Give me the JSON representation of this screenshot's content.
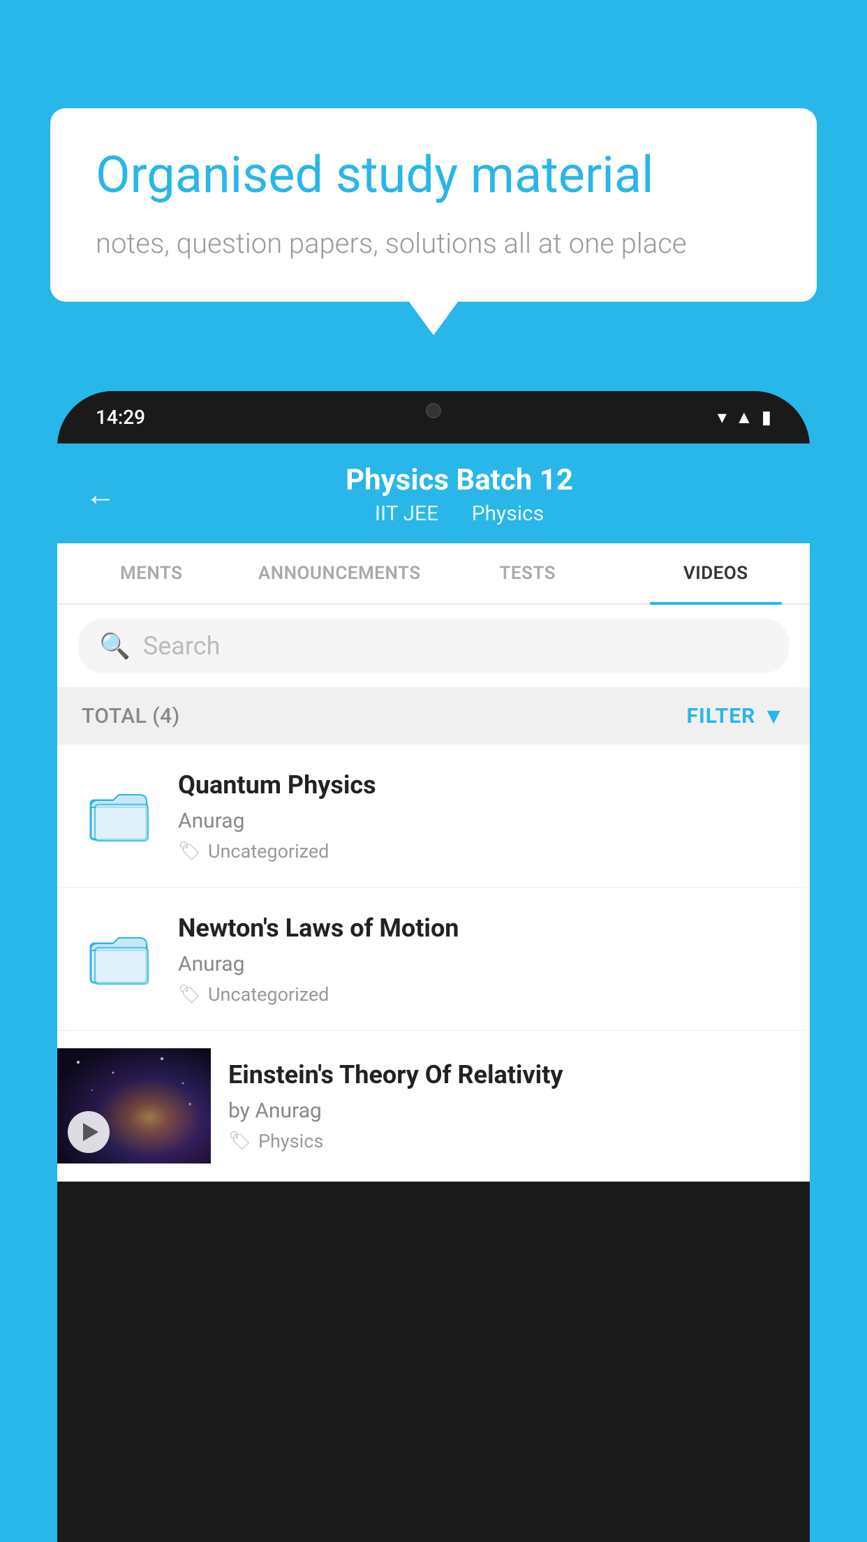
{
  "background_color": "#29b6e8",
  "bubble": {
    "title": "Organised study material",
    "subtitle": "notes, question papers, solutions all at one place"
  },
  "status_bar": {
    "time": "14:29",
    "icons": [
      "wifi",
      "signal",
      "battery"
    ]
  },
  "header": {
    "title": "Physics Batch 12",
    "tag1": "IIT JEE",
    "tag2": "Physics",
    "back_label": "←"
  },
  "tabs": [
    {
      "label": "MENTS",
      "active": false
    },
    {
      "label": "ANNOUNCEMENTS",
      "active": false
    },
    {
      "label": "TESTS",
      "active": false
    },
    {
      "label": "VIDEOS",
      "active": true
    }
  ],
  "search": {
    "placeholder": "Search"
  },
  "filter": {
    "total_label": "TOTAL (4)",
    "filter_label": "FILTER"
  },
  "videos": [
    {
      "title": "Quantum Physics",
      "author": "Anurag",
      "tag": "Uncategorized",
      "has_thumbnail": false
    },
    {
      "title": "Newton's Laws of Motion",
      "author": "Anurag",
      "tag": "Uncategorized",
      "has_thumbnail": false
    },
    {
      "title": "Einstein's Theory Of Relativity",
      "author": "by Anurag",
      "tag": "Physics",
      "has_thumbnail": true
    }
  ]
}
